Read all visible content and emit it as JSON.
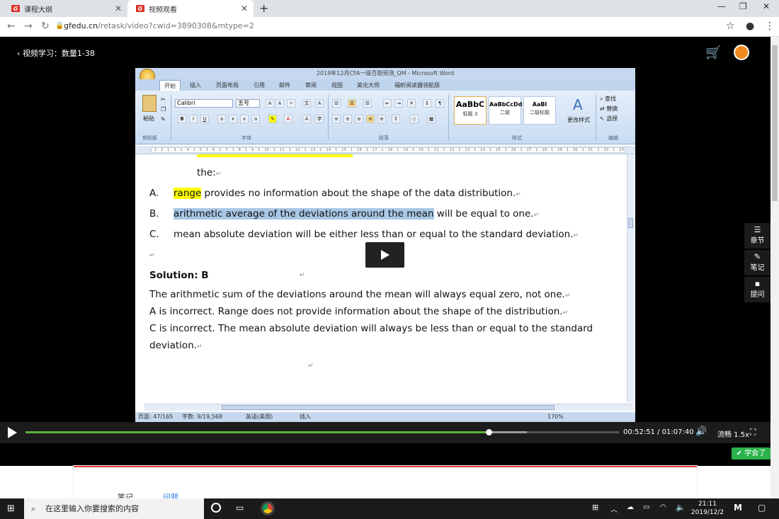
{
  "browser": {
    "tabs": [
      {
        "label": "课程大纲",
        "active": false
      },
      {
        "label": "视频观看",
        "active": true
      }
    ],
    "url_host": "gfedu.cn",
    "url_path": "/retask/video?cwid=3890308&mtype=2"
  },
  "page": {
    "back_label": "视频学习：数量1-38"
  },
  "word": {
    "title": "2019年12月CFA一级百题预测_QM - Microsoft Word",
    "tabs": [
      "开始",
      "插入",
      "页面布局",
      "引用",
      "邮件",
      "审阅",
      "视图",
      "美化大师",
      "福昕阅读器领航版"
    ],
    "font_name": "Calibri",
    "font_size": "五号",
    "paste_label": "粘贴",
    "groups": [
      "剪贴板",
      "字体",
      "段落",
      "样式",
      "编辑"
    ],
    "styles": [
      {
        "sample": "AaBbC",
        "name": "标题 3"
      },
      {
        "sample": "AaBbCcDd",
        "name": "二级"
      },
      {
        "sample": "AaBl",
        "name": "二级标题"
      }
    ],
    "change_style": "更改样式",
    "edit_items": [
      "查找",
      "替换",
      "选择"
    ],
    "status": {
      "page": "页面: 47/165",
      "words": "字数: 9/19,568",
      "lang": "英语(美国)",
      "mode": "插入",
      "zoom": "170%"
    },
    "doc": {
      "line_the": "the:",
      "optA_letter": "A.",
      "optA_hl": "range",
      "optA_rest": " provides no information about the shape of the data distribution.",
      "optB_letter": "B.",
      "optB_hl": "arithmetic average of the deviations around the mean",
      "optB_rest": " will be equal to one.",
      "optC_letter": "C.",
      "optC_text": "mean absolute deviation will be either less than or equal to the standard deviation.",
      "solution": "Solution: B",
      "sol1": "The arithmetic sum of the deviations around the mean will always equal zero, not one.",
      "sol2": "A is incorrect. Range does not provide information about the shape of the distribution.",
      "sol3": "C is incorrect. The mean absolute deviation will always be less than or equal to the standard",
      "sol4": "deviation."
    }
  },
  "side": {
    "chapter": "章节",
    "notes": "笔记",
    "ask": "提问"
  },
  "player": {
    "progress_fraction": 0.78,
    "current_time": "00:52:51",
    "total_time": "01:07:40",
    "speed_label": "流畅 1.5x",
    "learned_label": "学会了"
  },
  "content_tabs": {
    "notes": "笔记",
    "questions": "问题"
  },
  "taskbar": {
    "search_placeholder": "在这里输入你要搜索的内容",
    "time": "21:11",
    "date": "2019/12/2"
  }
}
